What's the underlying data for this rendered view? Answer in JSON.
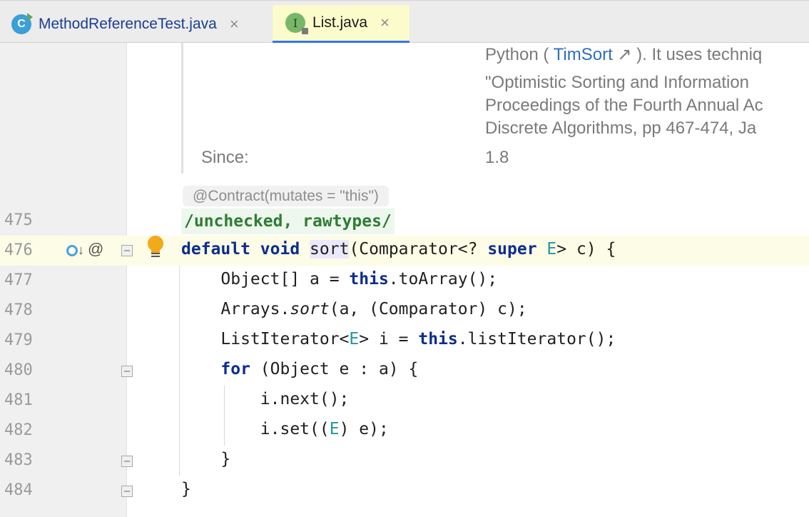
{
  "tabs": [
    {
      "name": "MethodReferenceTest.java",
      "badge": "C",
      "close": "×"
    },
    {
      "name": "List.java",
      "badge": "I",
      "close": "×"
    }
  ],
  "doc": {
    "line1_pre": "Python ( ",
    "line1_link": "TimSort",
    "line1_arrow": "↗",
    "line1_post": " ). It uses techniq",
    "line2": "\"Optimistic Sorting and Information",
    "line3": "Proceedings of the Fourth Annual Ac",
    "line4": "Discrete Algorithms, pp 467-474, Ja",
    "since_label": "Since:",
    "since_value": "1.8"
  },
  "inlays": {
    "contract": "@Contract(mutates = \"this\")",
    "suppress": "/unchecked, rawtypes/"
  },
  "line_numbers": [
    "475",
    "476",
    "477",
    "478",
    "479",
    "480",
    "481",
    "482",
    "483",
    "484"
  ],
  "code": {
    "l476": {
      "kw1": "default",
      "kw2": "void",
      "method": "sort",
      "rest1": "(Comparator<? ",
      "kw3": "super",
      "tp": "E",
      "rest2": "> c) {"
    },
    "l477": {
      "pre": "    Object[] a = ",
      "kw": "this",
      "post": ".toArray();"
    },
    "l478": {
      "pre": "    Arrays.",
      "it": "sort",
      "post": "(a, (Comparator) c);"
    },
    "l479": {
      "pre": "    ListIterator<",
      "tp": "E",
      "mid": "> i = ",
      "kw": "this",
      "post": ".listIterator();"
    },
    "l480": {
      "pre": "    ",
      "kw": "for",
      "post": " (Object e : a) {"
    },
    "l481": {
      "text": "        i.next();"
    },
    "l482": {
      "pre": "        i.set((",
      "tp": "E",
      "post": ") e);"
    },
    "l483": {
      "text": "    }"
    },
    "l484": {
      "text": "}"
    }
  },
  "icons": {
    "overrides": "o↓",
    "at": "@"
  }
}
